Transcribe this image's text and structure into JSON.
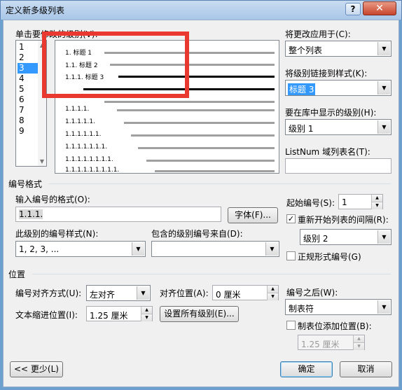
{
  "window": {
    "title": "定义新多级列表",
    "help_label": "?",
    "close_label": "✕"
  },
  "level_list": {
    "label": "单击要修改的级别(V):",
    "items": [
      "1",
      "2",
      "3",
      "4",
      "5",
      "6",
      "7",
      "8",
      "9"
    ],
    "selected": "3"
  },
  "preview": {
    "labels": [
      "1. 标题 1",
      "1.1. 标题 2",
      "1.1.1. 标题 3"
    ],
    "numbers": [
      "1.1.1.1.",
      "1.1.1.1.1.",
      "1.1.1.1.1.1.",
      "1.1.1.1.1.1.1.",
      "1.1.1.1.1.1.1.1.",
      "1.1.1.1.1.1.1.1.1."
    ]
  },
  "right_panel": {
    "apply_label": "将更改应用于(C):",
    "apply_value": "整个列表",
    "link_label": "将级别链接到样式(K):",
    "link_value": "标题 3",
    "gallery_label": "要在库中显示的级别(H):",
    "gallery_value": "级别 1",
    "listnum_label": "ListNum 域列表名(T):",
    "listnum_value": ""
  },
  "number_format": {
    "section_title": "编号格式",
    "format_label": "输入编号的格式(O):",
    "format_value": "1.1.1.",
    "font_button": "字体(F)...",
    "style_label": "此级别的编号样式(N):",
    "style_value": "1, 2, 3, ...",
    "include_label": "包含的级别编号来自(D):",
    "include_value": "",
    "start_label": "起始编号(S):",
    "start_value": "1",
    "restart_label": "重新开始列表的间隔(R):",
    "restart_checked": true,
    "restart_value": "级别 2",
    "legal_label": "正规形式编号(G)",
    "legal_checked": false
  },
  "position": {
    "section_title": "位置",
    "align_label": "编号对齐方式(U):",
    "align_value": "左对齐",
    "align_at_label": "对齐位置(A):",
    "align_at_value": "0 厘米",
    "indent_label": "文本缩进位置(I):",
    "indent_value": "1.25 厘米",
    "set_all_button": "设置所有级别(E)...",
    "follow_label": "编号之后(W):",
    "follow_value": "制表符",
    "tab_label": "制表位添加位置(B):",
    "tab_checked": false,
    "tab_value": "1.25 厘米"
  },
  "footer": {
    "less_button": "<< 更少(L)",
    "ok_button": "确定",
    "cancel_button": "取消"
  }
}
